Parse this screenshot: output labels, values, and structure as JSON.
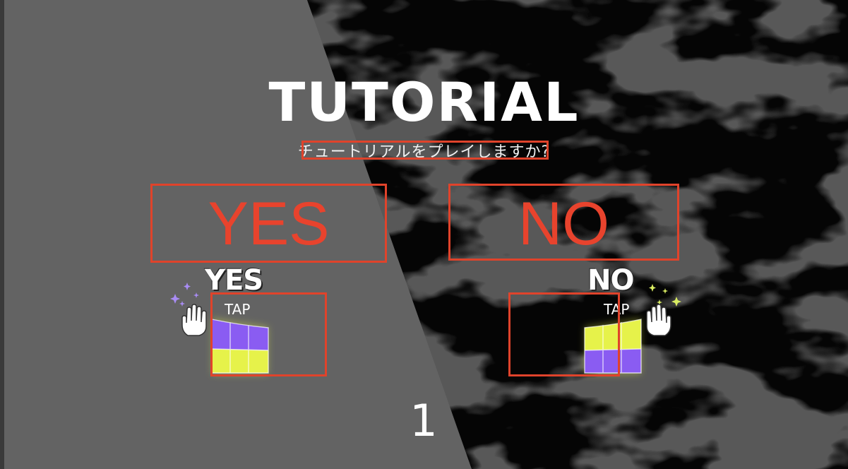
{
  "screen": {
    "title": "TUTORIAL",
    "prompt": "チュートリアルをプレイしますか?",
    "countdown": "1"
  },
  "yes_option": {
    "annotation_label": "YES",
    "button_label": "YES",
    "tap_hint": "TAP",
    "pad_colors": {
      "top": "#8a5cf2",
      "bottom": "#e6f24a"
    },
    "sparkle_color": "#a98cf5",
    "hand_icon": "hand-icon"
  },
  "no_option": {
    "annotation_label": "NO",
    "button_label": "NO",
    "tap_hint": "TAP",
    "pad_colors": {
      "top": "#e6f24a",
      "bottom": "#8a5cf2"
    },
    "sparkle_color": "#d9ec62",
    "hand_icon": "hand-icon"
  },
  "colors": {
    "annotation_red": "#e0432b",
    "left_panel_gray": "#636363",
    "background": "#050505"
  }
}
